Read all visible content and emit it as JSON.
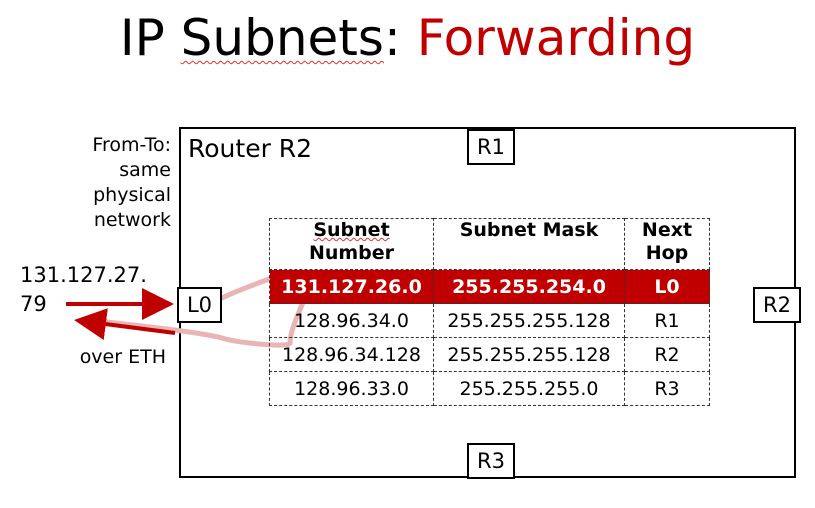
{
  "title": {
    "prefix": "IP ",
    "word": "Subnets",
    "colon": ": ",
    "highlight": "Forwarding"
  },
  "router_label": "Router R2",
  "ports": {
    "r1": "R1",
    "r2": "R2",
    "r3": "R3",
    "l0": "L0"
  },
  "notes": {
    "from_to": [
      "From-To:",
      "same",
      "physical",
      "network"
    ],
    "ip_lines": [
      "131.127.27.",
      "79"
    ],
    "over_eth": "over ETH"
  },
  "table": {
    "headers": [
      {
        "line1": "Subnet",
        "line2": "Number"
      },
      {
        "line1": "Subnet Mask",
        "line2": ""
      },
      {
        "line1": "Next",
        "line2": "Hop"
      }
    ],
    "rows": [
      [
        "131.127.26.0",
        "255.255.254.0",
        "L0"
      ],
      [
        "128.96.34.0",
        "255.255.255.128",
        "R1"
      ],
      [
        "128.96.34.128",
        "255.255.255.128",
        "R2"
      ],
      [
        "128.96.33.0",
        "255.255.255.0",
        "R3"
      ]
    ],
    "highlight_row": 0
  },
  "colors": {
    "accent": "#c00000",
    "route_curve": "#e8b4b4"
  }
}
